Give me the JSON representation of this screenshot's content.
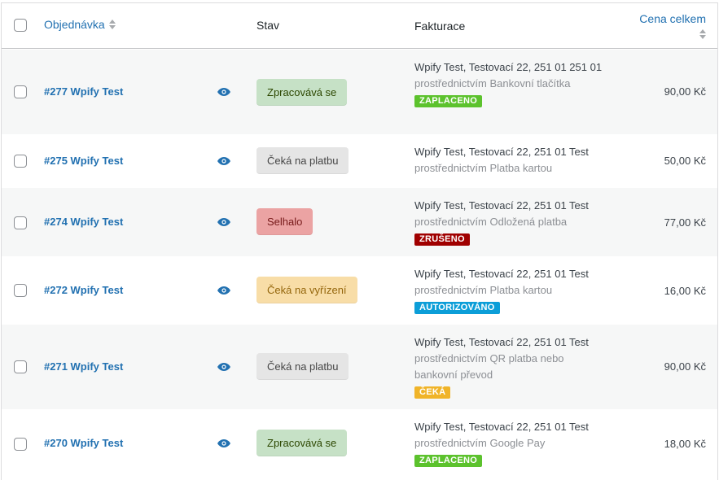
{
  "header": {
    "order": "Objednávka",
    "status": "Stav",
    "billing": "Fakturace",
    "total": "Cena celkem"
  },
  "colors": {
    "link": "#2271b1",
    "processing": "#c6e1c6",
    "on_hold": "#e5e5e5",
    "failed": "#eba3a3",
    "pending": "#f8dda7",
    "badge_paid": "#5cc22d",
    "badge_cancelled": "#a00000",
    "badge_authorized": "#0c9ed8",
    "badge_waiting": "#f0b429"
  },
  "orders": [
    {
      "label": "#277 Wpify Test",
      "status": "Zpracovává se",
      "address": "Wpify Test, Testovací 22, 251 01 251 01",
      "via": "prostřednictvím Bankovní tlačítka",
      "badge": "ZAPLACENO",
      "total": "90,00 Kč"
    },
    {
      "label": "#275 Wpify Test",
      "status": "Čeká na platbu",
      "address": "Wpify Test, Testovací 22, 251 01 Test",
      "via": "prostřednictvím Platba kartou",
      "badge": "",
      "total": "50,00 Kč"
    },
    {
      "label": "#274 Wpify Test",
      "status": "Selhalo",
      "address": "Wpify Test, Testovací 22, 251 01 Test",
      "via": "prostřednictvím Odložená platba",
      "badge": "ZRUŠENO",
      "total": "77,00 Kč"
    },
    {
      "label": "#272 Wpify Test",
      "status": "Čeká na vyřízení",
      "address": "Wpify Test, Testovací 22, 251 01 Test",
      "via": "prostřednictvím Platba kartou",
      "badge": "AUTORIZOVÁNO",
      "total": "16,00 Kč"
    },
    {
      "label": "#271 Wpify Test",
      "status": "Čeká na platbu",
      "address": "Wpify Test, Testovací 22, 251 01 Test",
      "via": "prostřednictvím QR platba nebo bankovní převod",
      "badge": "ČEKÁ",
      "total": "90,00 Kč"
    },
    {
      "label": "#270 Wpify Test",
      "status": "Zpracovává se",
      "address": "Wpify Test, Testovací 22, 251 01 Test",
      "via": "prostřednictvím Google Pay",
      "badge": "ZAPLACENO",
      "total": "18,00 Kč"
    }
  ]
}
